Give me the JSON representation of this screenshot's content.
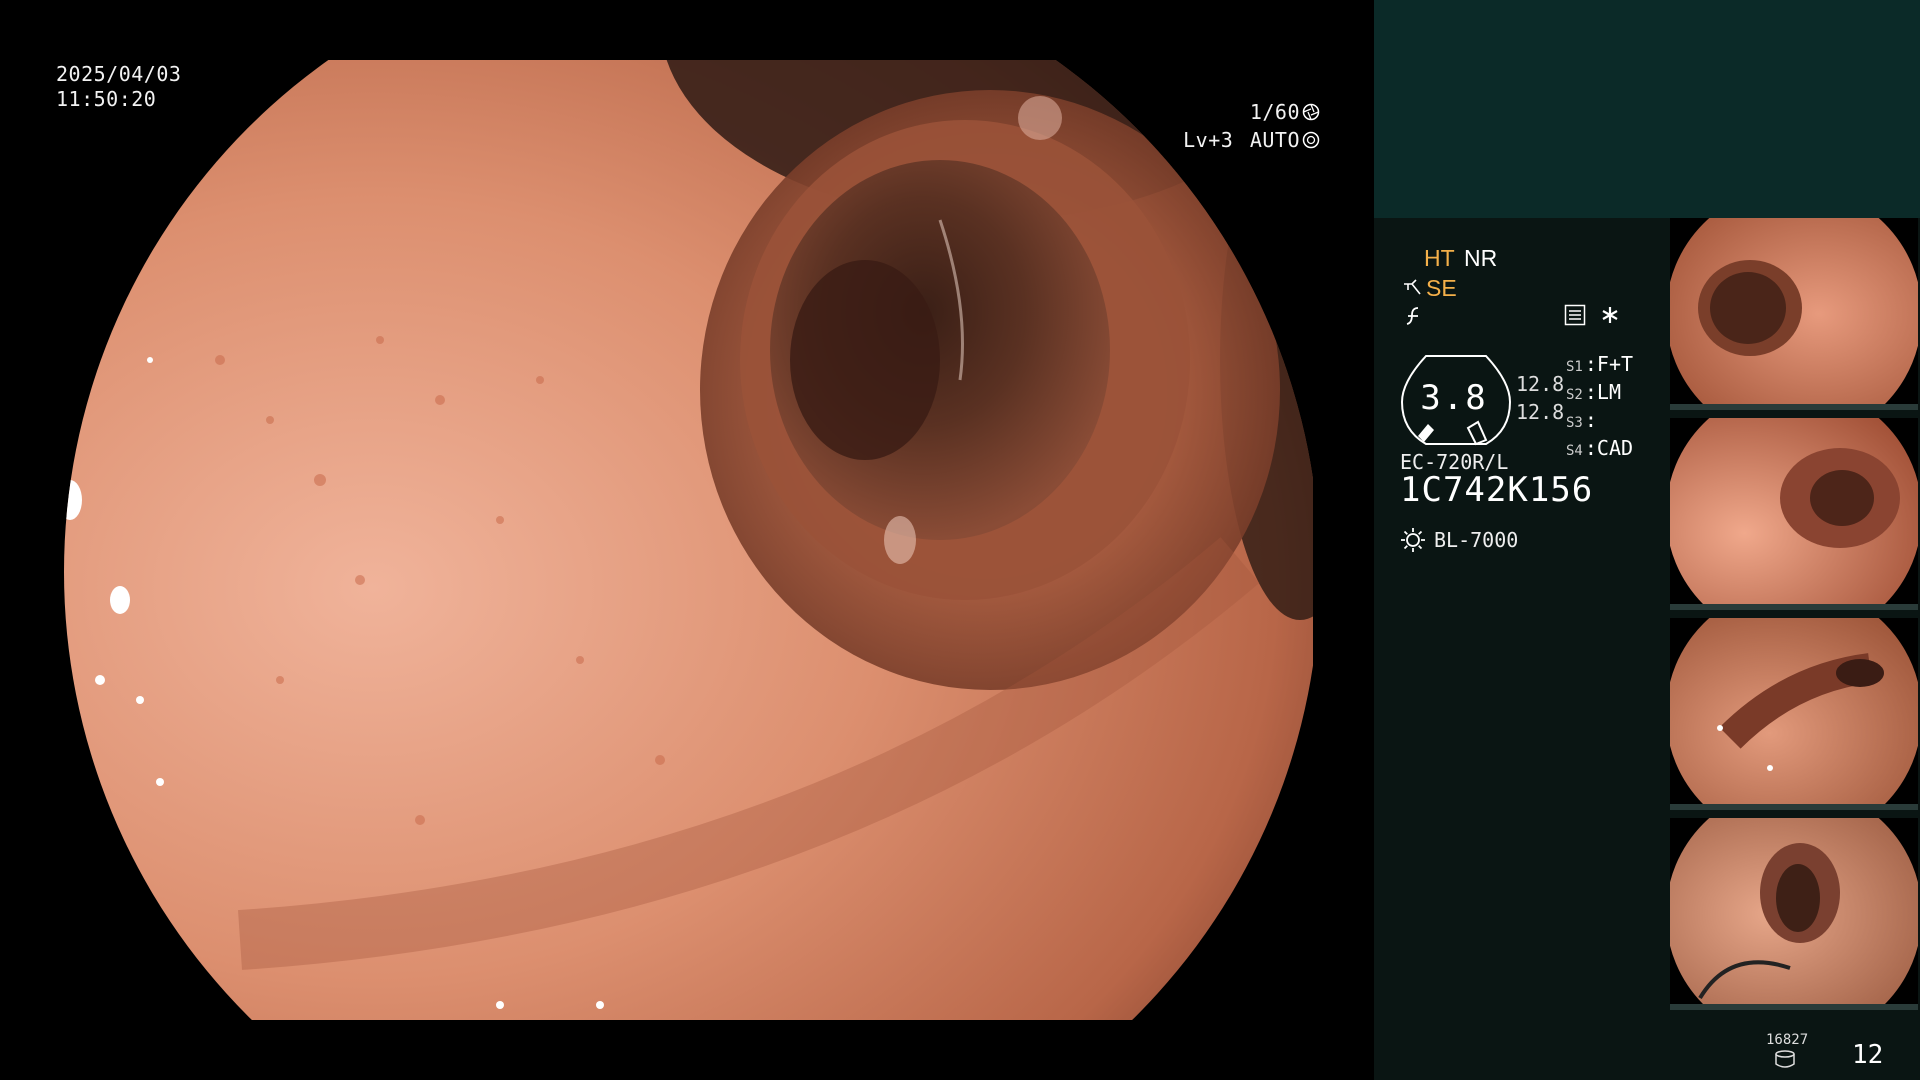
{
  "osd": {
    "date": "2025/04/03",
    "time": "11:50:20",
    "shutter": "1/60",
    "level": "Lv+3",
    "iris_mode": "AUTO"
  },
  "modes": {
    "ht": "HT",
    "nr": "NR",
    "se": "SE"
  },
  "zoom": {
    "value": "3.8",
    "values_side": [
      "12.8",
      "12.8"
    ]
  },
  "switch_settings": [
    {
      "label": "S1",
      "value": "F+T"
    },
    {
      "label": "S2",
      "value": "LM"
    },
    {
      "label": "S3",
      "value": ""
    },
    {
      "label": "S4",
      "value": "CAD"
    }
  ],
  "scope": {
    "model": "EC-720R/L",
    "serial": "1C742K156",
    "light_source": "BL-7000"
  },
  "capture": {
    "count_small": "16827",
    "count_big": "12"
  },
  "thumbnails": [
    {
      "id": "thumb-1"
    },
    {
      "id": "thumb-2"
    },
    {
      "id": "thumb-3"
    },
    {
      "id": "thumb-4"
    }
  ],
  "colors": {
    "panel_top": "#0b2a28",
    "panel": "#0a1513",
    "accent_orange": "#f4b04a",
    "mucosa": "#d98a6a"
  },
  "icons": [
    "shutter-icon",
    "iris-icon",
    "hose-icon",
    "freeze-icon",
    "menu-icon",
    "star-icon",
    "lamp-icon",
    "database-icon"
  ]
}
